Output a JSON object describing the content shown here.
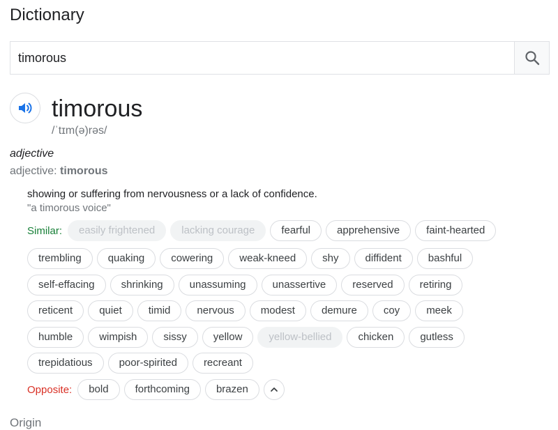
{
  "app_title": "Dictionary",
  "search": {
    "value": "timorous",
    "button_icon": "search-icon"
  },
  "entry": {
    "audio_icon": "speaker-icon",
    "word": "timorous",
    "phonetic": "/ˈtɪm(ə)rəs/",
    "part_of_speech": "adjective",
    "inflection_label": "adjective:",
    "inflection_word": "timorous",
    "definition": "showing or suffering from nervousness or a lack of confidence.",
    "example": "\"a timorous voice\""
  },
  "similar_label": "Similar:",
  "similar_rows": [
    [
      {
        "text": "easily frightened",
        "muted": true
      },
      {
        "text": "lacking courage",
        "muted": true
      },
      {
        "text": "fearful",
        "muted": false
      },
      {
        "text": "apprehensive",
        "muted": false
      },
      {
        "text": "faint-hearted",
        "muted": false
      }
    ],
    [
      {
        "text": "trembling",
        "muted": false
      },
      {
        "text": "quaking",
        "muted": false
      },
      {
        "text": "cowering",
        "muted": false
      },
      {
        "text": "weak-kneed",
        "muted": false
      },
      {
        "text": "shy",
        "muted": false
      },
      {
        "text": "diffident",
        "muted": false
      },
      {
        "text": "bashful",
        "muted": false
      }
    ],
    [
      {
        "text": "self-effacing",
        "muted": false
      },
      {
        "text": "shrinking",
        "muted": false
      },
      {
        "text": "unassuming",
        "muted": false
      },
      {
        "text": "unassertive",
        "muted": false
      },
      {
        "text": "reserved",
        "muted": false
      },
      {
        "text": "retiring",
        "muted": false
      }
    ],
    [
      {
        "text": "reticent",
        "muted": false
      },
      {
        "text": "quiet",
        "muted": false
      },
      {
        "text": "timid",
        "muted": false
      },
      {
        "text": "nervous",
        "muted": false
      },
      {
        "text": "modest",
        "muted": false
      },
      {
        "text": "demure",
        "muted": false
      },
      {
        "text": "coy",
        "muted": false
      },
      {
        "text": "meek",
        "muted": false
      }
    ],
    [
      {
        "text": "humble",
        "muted": false
      },
      {
        "text": "wimpish",
        "muted": false
      },
      {
        "text": "sissy",
        "muted": false
      },
      {
        "text": "yellow",
        "muted": false
      },
      {
        "text": "yellow-bellied",
        "muted": true
      },
      {
        "text": "chicken",
        "muted": false
      },
      {
        "text": "gutless",
        "muted": false
      }
    ],
    [
      {
        "text": "trepidatious",
        "muted": false
      },
      {
        "text": "poor-spirited",
        "muted": false
      },
      {
        "text": "recreant",
        "muted": false
      }
    ]
  ],
  "opposite_label": "Opposite:",
  "opposite_words": [
    "bold",
    "forthcoming",
    "brazen"
  ],
  "collapse_icon": "chevron-up-icon",
  "origin_heading": "Origin",
  "colors": {
    "similar_label": "#188038",
    "opposite_label": "#d93025",
    "speaker_blue": "#1a73e8",
    "muted_chip_bg": "#f1f3f4"
  }
}
